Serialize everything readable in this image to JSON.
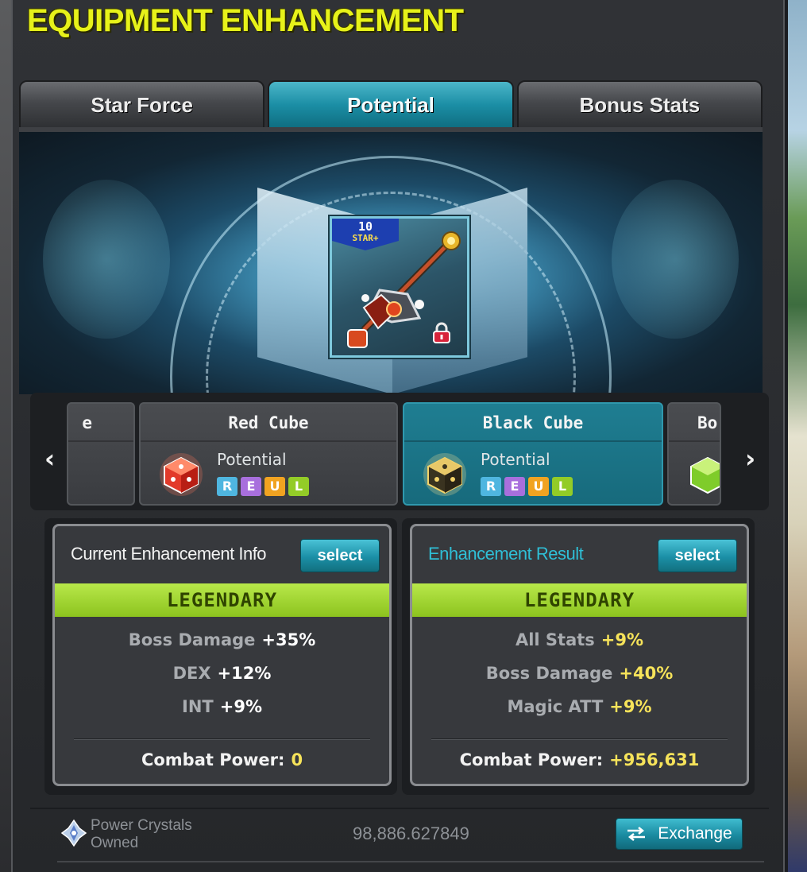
{
  "window": {
    "title": "EQUIPMENT ENHANCEMENT"
  },
  "tabs": [
    {
      "label": "Star Force",
      "active": false
    },
    {
      "label": "Potential",
      "active": true
    },
    {
      "label": "Bonus Stats",
      "active": false
    }
  ],
  "item": {
    "star_badge_number": "10",
    "star_badge_text": "STAR+",
    "icon": "staff-weapon-icon",
    "locked": true
  },
  "cube_selector": {
    "prev_arrow": "‹",
    "next_arrow": "›",
    "cards": [
      {
        "name": "e",
        "partial": true
      },
      {
        "name": "Red Cube",
        "type_label": "Potential",
        "grades": [
          "R",
          "E",
          "U",
          "L"
        ],
        "icon": "red-cube-icon",
        "active": false
      },
      {
        "name": "Black Cube",
        "type_label": "Potential",
        "grades": [
          "R",
          "E",
          "U",
          "L"
        ],
        "icon": "black-cube-icon",
        "active": true
      },
      {
        "name": "Bo",
        "partial": true,
        "icon": "green-cube-icon"
      }
    ]
  },
  "current_info": {
    "header": "Current Enhancement Info",
    "select_label": "select",
    "grade": "LEGENDARY",
    "lines": [
      {
        "label": "Boss Damage",
        "value": "+35%"
      },
      {
        "label": "DEX",
        "value": "+12%"
      },
      {
        "label": "INT",
        "value": "+9%"
      }
    ],
    "combat_power_label": "Combat Power:",
    "combat_power_value": "0"
  },
  "result_info": {
    "header": "Enhancement Result",
    "select_label": "select",
    "grade": "LEGENDARY",
    "lines": [
      {
        "label": "All Stats",
        "value": "+9%"
      },
      {
        "label": "Boss Damage",
        "value": "+40%"
      },
      {
        "label": "Magic ATT",
        "value": "+9%"
      }
    ],
    "combat_power_label": "Combat Power:",
    "combat_power_value": "+956,631"
  },
  "footer": {
    "power_crystals_label_1": "Power Crystals",
    "power_crystals_label_2": "Owned",
    "power_crystals_value": "98,886.627849",
    "exchange_label": "Exchange",
    "exchange_icon": "swap-arrows-icon"
  },
  "colors": {
    "title": "#e7f21a",
    "accent": "#1b8ea5",
    "legendary": "#8cc31e",
    "value_highlight": "#f6e35a"
  }
}
